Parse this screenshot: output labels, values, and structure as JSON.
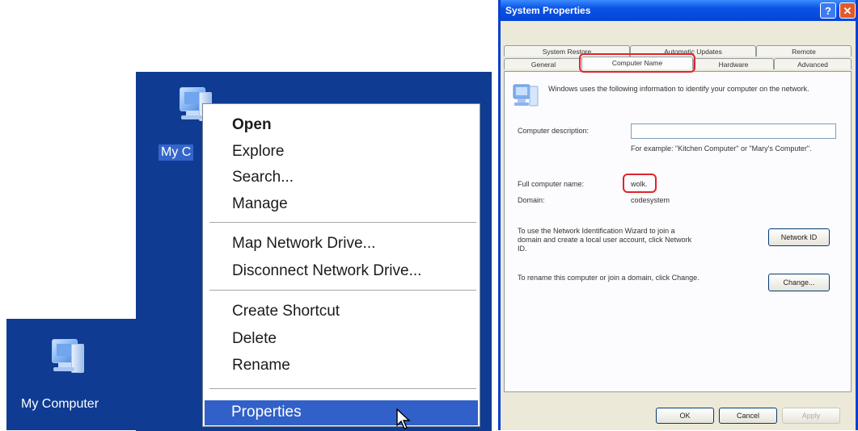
{
  "desktop": {
    "icon_label_partial": "My C",
    "icon_label": "My Computer"
  },
  "context_menu": {
    "items": [
      {
        "label": "Open",
        "bold": true
      },
      {
        "label": "Explore"
      },
      {
        "label": "Search..."
      },
      {
        "label": "Manage"
      },
      {
        "label": "Map Network Drive..."
      },
      {
        "label": "Disconnect Network Drive..."
      },
      {
        "label": "Create Shortcut"
      },
      {
        "label": "Delete"
      },
      {
        "label": "Rename"
      },
      {
        "label": "Properties",
        "highlighted": true
      }
    ]
  },
  "dialog": {
    "title": "System Properties",
    "help_glyph": "?",
    "close_glyph": "✕",
    "tabs_row1": [
      "System Restore",
      "Automatic Updates",
      "Remote"
    ],
    "tabs_row2": [
      "General",
      "Computer Name",
      "Hardware",
      "Advanced"
    ],
    "active_tab": "Computer Name",
    "intro": "Windows uses the following information to identify your computer on the network.",
    "description_label": "Computer description:",
    "description_value": "",
    "example_text": "For example: \"Kitchen Computer\" or \"Mary's Computer\".",
    "full_name_label": "Full computer name:",
    "full_name_value": "wolk.",
    "domain_label": "Domain:",
    "domain_value": "codesystem",
    "network_id_text": "To use the Network Identification Wizard to join a domain and create a local user account, click Network ID.",
    "network_id_button": "Network ID",
    "rename_text": "To rename this computer or join a domain, click Change.",
    "change_button": "Change...",
    "ok_button": "OK",
    "cancel_button": "Cancel",
    "apply_button": "Apply"
  },
  "colors": {
    "desktop_blue": "#0f3c92",
    "menu_highlight": "#3161c8",
    "annotation_red": "#e0242c",
    "xp_title_blue": "#0a52e6"
  }
}
